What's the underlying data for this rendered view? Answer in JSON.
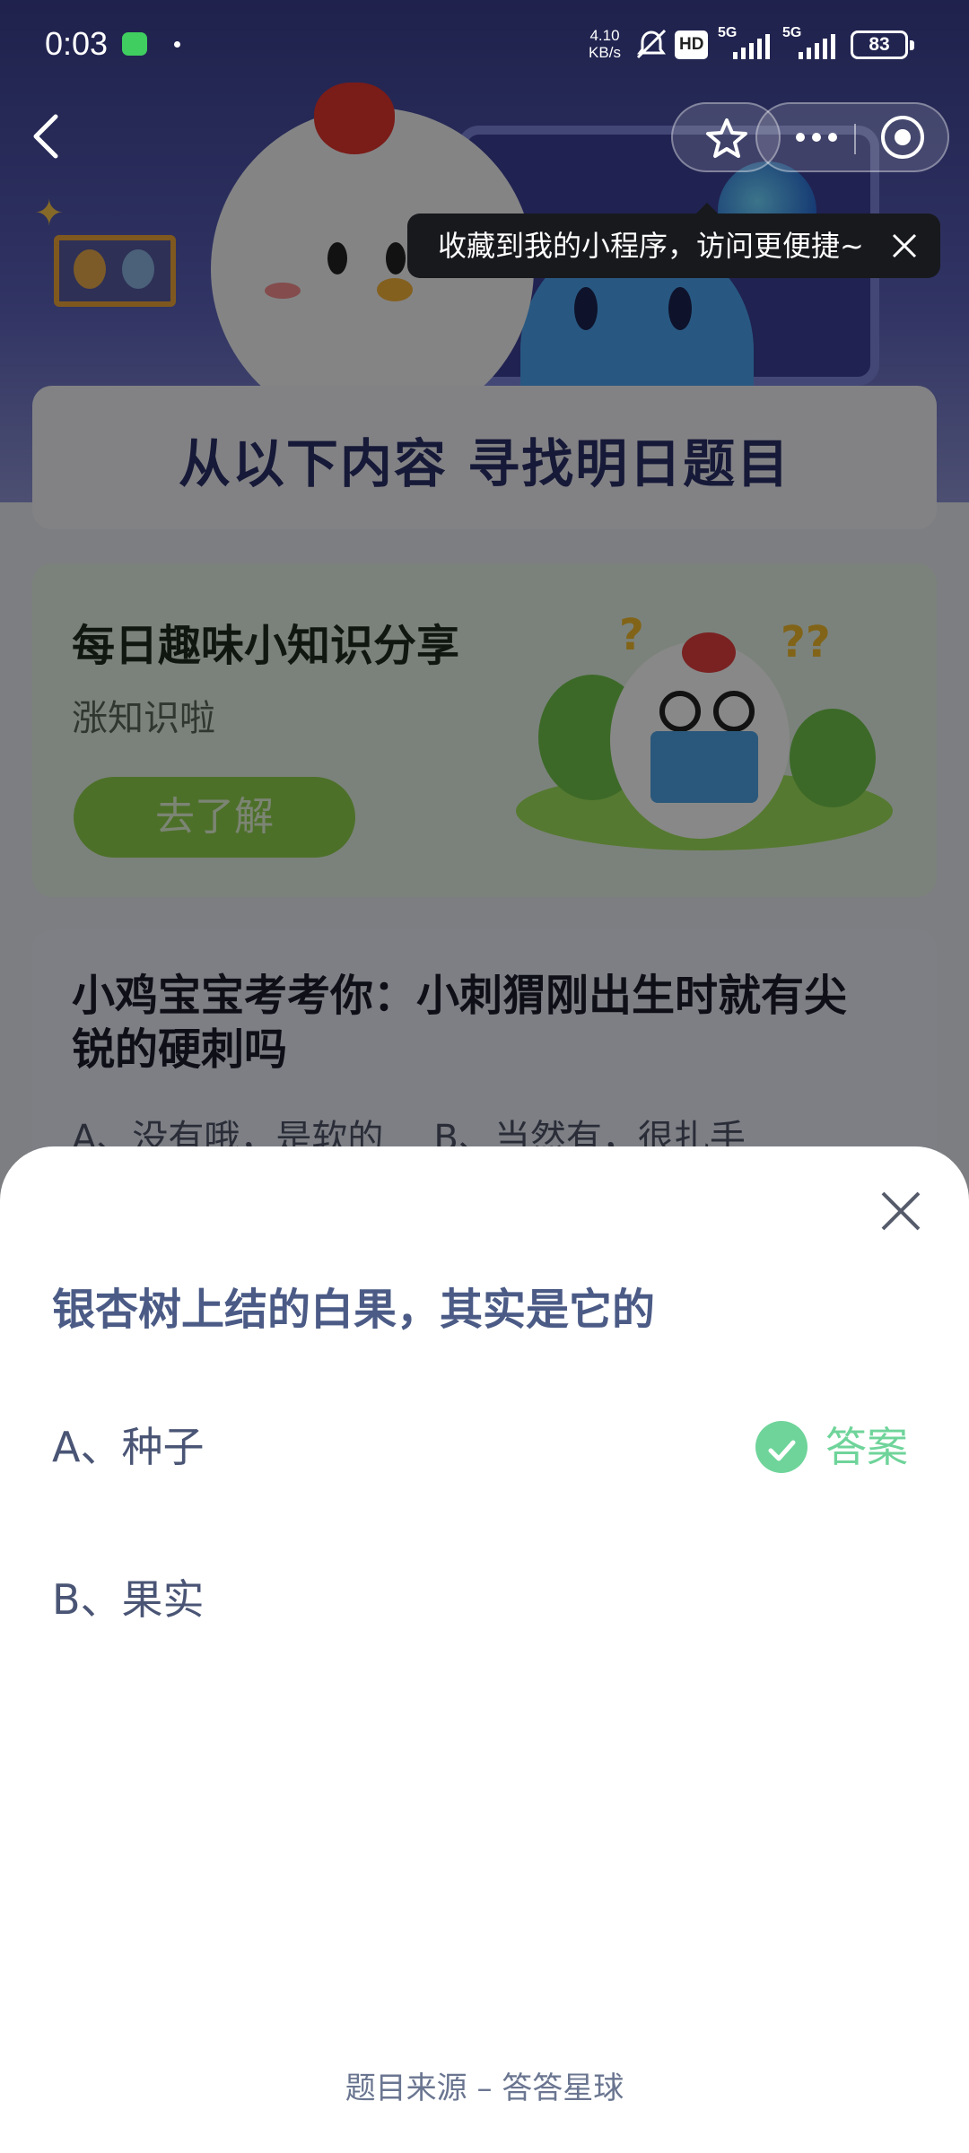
{
  "status_bar": {
    "time": "0:03",
    "net_speed_value": "4.10",
    "net_speed_unit": "KB/s",
    "hd_label": "HD",
    "sim1_label": "5G",
    "sim2_label": "5G",
    "battery": "83"
  },
  "banner": {
    "tooltip_text": "收藏到我的小程序，访问更便捷~"
  },
  "background": {
    "find_title": "从以下内容  寻找明日题目",
    "knowledge_title": "每日趣味小知识分享",
    "knowledge_sub": "涨知识啦",
    "knowledge_button": "去了解",
    "quiz_title": "小鸡宝宝考考你：小刺猬刚出生时就有尖锐的硬刺吗",
    "quiz_option_a": "A、没有哦，是软的",
    "quiz_option_b": "B、当然有，很扎手"
  },
  "sheet": {
    "question": "银杏树上结的白果，其实是它的",
    "options": [
      {
        "label": "A、种子",
        "is_answer": true
      },
      {
        "label": "B、果实",
        "is_answer": false
      }
    ],
    "answer_label": "答案",
    "source": "题目来源 – 答答星球"
  },
  "colors": {
    "question_text": "#4b5b86",
    "answer_green": "#6fd49a",
    "overlay": "rgba(0,0,0,0.46)",
    "tooltip_bg": "#18191d"
  },
  "icons": [
    "back-arrow-icon",
    "star-icon",
    "more-dots-icon",
    "target-icon",
    "close-icon",
    "check-icon",
    "wechat-icon",
    "mute-bell-icon",
    "signal-icon",
    "battery-icon"
  ]
}
